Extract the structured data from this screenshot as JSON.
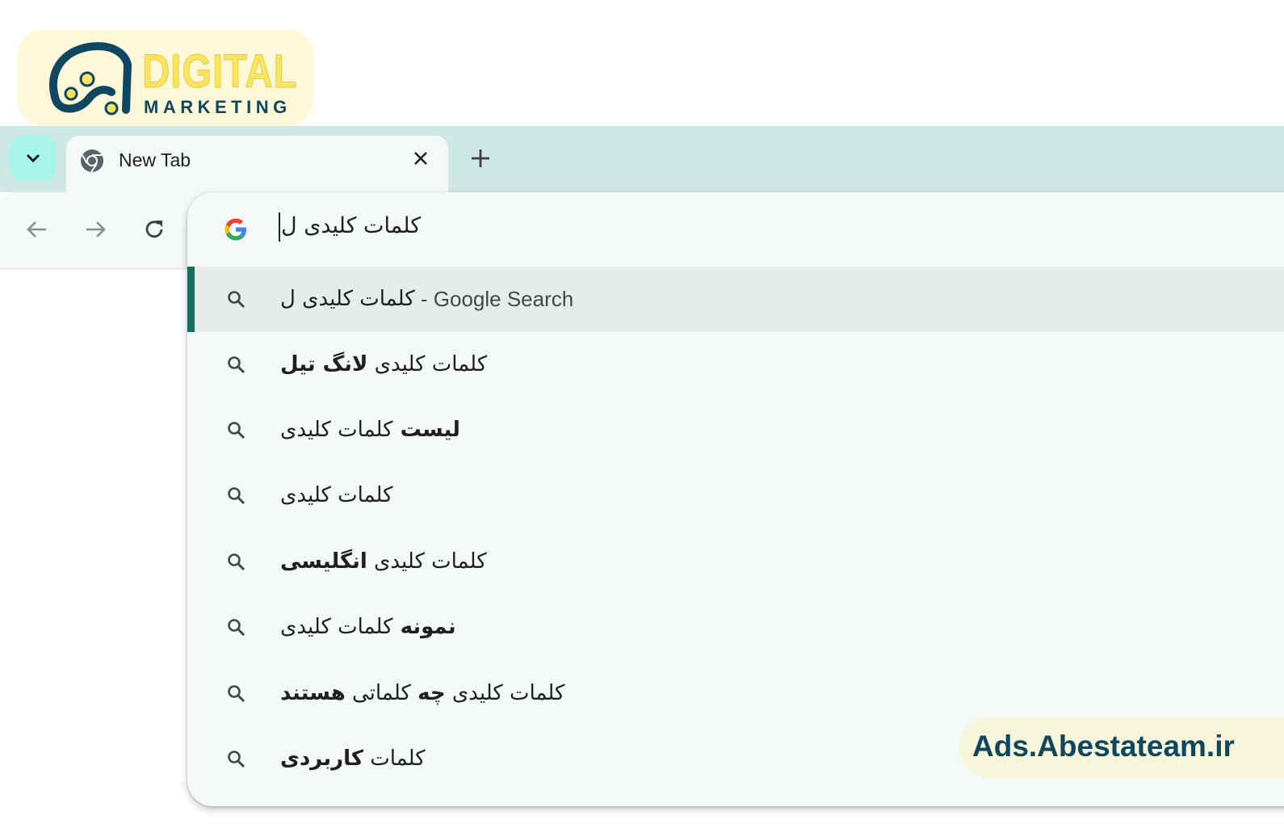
{
  "logo": {
    "word1": "DIGITAL",
    "word2": "MARKETING"
  },
  "tab": {
    "title": "New Tab",
    "favicon": "chrome-icon",
    "close_icon": "close-icon"
  },
  "tabstrip": {
    "search_icon": "chevron-down-icon",
    "new_tab_icon": "plus-icon"
  },
  "toolbar": {
    "back_icon": "arrow-left-icon",
    "forward_icon": "arrow-right-icon",
    "reload_icon": "reload-icon"
  },
  "omnibox": {
    "provider_icon": "google-icon",
    "query": "کلمات کلیدی ل",
    "suggestions": [
      {
        "normal": "کلمات کلیدی ل",
        "bold": "",
        "suffix": " - Google Search",
        "order": "plain"
      },
      {
        "normal": "کلمات کلیدی ",
        "bold": "لانگ تیل",
        "order": "normal-first"
      },
      {
        "normal": "کلمات کلیدی",
        "bold": "لیست ",
        "order": "bold-first"
      },
      {
        "normal": "کلمات کلیدی",
        "bold": "",
        "order": "plain"
      },
      {
        "normal": "کلمات کلیدی ",
        "bold": "انگلیسی",
        "order": "normal-first"
      },
      {
        "normal": "کلمات کلیدی",
        "bold": "نمونه ",
        "order": "bold-first"
      },
      {
        "normal": "کلمات کلیدی ",
        "bold": "چه",
        "normal2": " کلماتی ",
        "bold2": "هستند",
        "order": "mixed"
      },
      {
        "normal": "کلمات ",
        "bold": "کاربردی",
        "order": "normal-first"
      }
    ]
  },
  "watermark": "Ads.Abestateam.ir",
  "colors": {
    "tabstrip": "#cfe8e3",
    "accent": "#1e6b5f",
    "badge_text": "#0f4761"
  }
}
